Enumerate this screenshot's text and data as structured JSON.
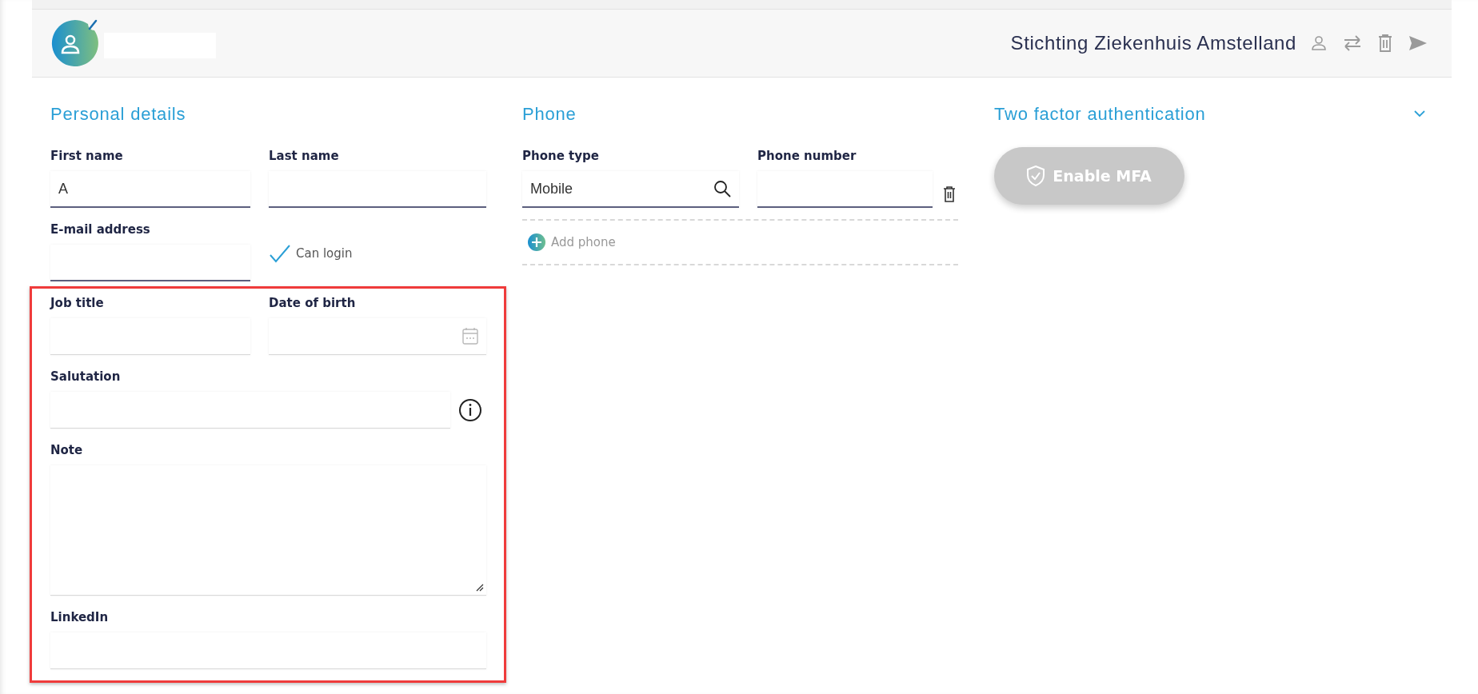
{
  "header": {
    "org_name": "Stichting Ziekenhuis Amstelland"
  },
  "personal_details": {
    "title": "Personal details",
    "first_name": {
      "label": "First name",
      "value": "A"
    },
    "last_name": {
      "label": "Last name"
    },
    "email": {
      "label": "E-mail address"
    },
    "can_login": {
      "label": "Can login",
      "checked": true
    },
    "job_title": {
      "label": "Job title"
    },
    "date_of_birth": {
      "label": "Date of birth"
    },
    "salutation": {
      "label": "Salutation"
    },
    "note": {
      "label": "Note"
    },
    "linkedin": {
      "label": "LinkedIn"
    }
  },
  "phone": {
    "title": "Phone",
    "phones": [
      {
        "type_label": "Phone type",
        "type_value": "Mobile",
        "number_label": "Phone number"
      }
    ],
    "add_label": "Add phone"
  },
  "two_factor": {
    "title": "Two factor authentication",
    "button": {
      "label": "Enable MFA",
      "disabled": true
    }
  }
}
